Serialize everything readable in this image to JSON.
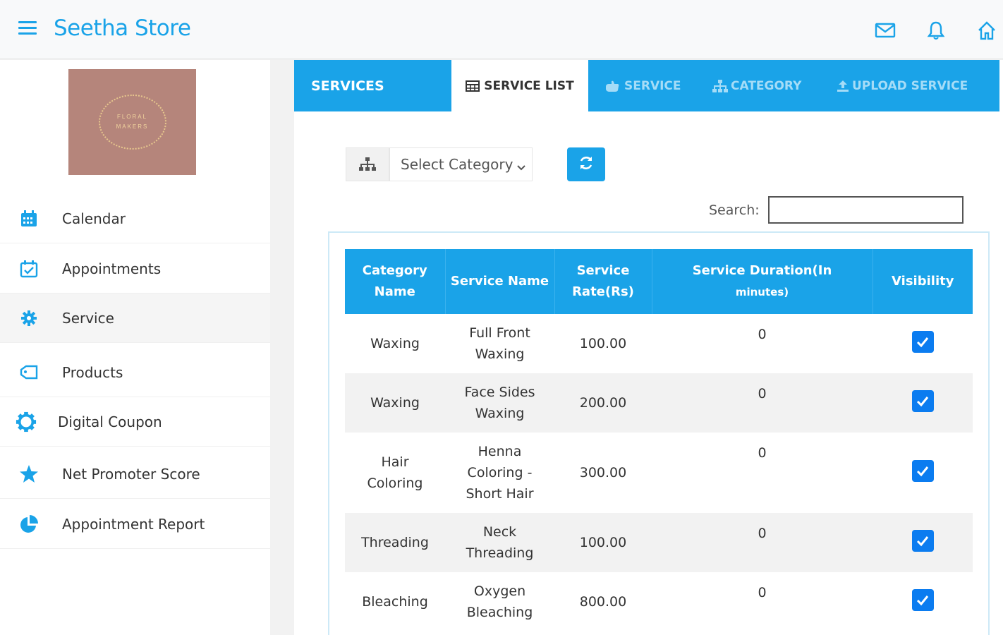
{
  "app": {
    "title": "Seetha Store"
  },
  "header": {
    "icons": [
      "mail-icon",
      "bell-icon",
      "home-icon"
    ]
  },
  "logo": {
    "line1": "FLORAL",
    "line2": "MAKERS"
  },
  "sidebar": {
    "items": [
      {
        "label": "Calendar",
        "icon": "calendar-icon"
      },
      {
        "label": "Appointments",
        "icon": "calendar-check-icon"
      },
      {
        "label": "Service",
        "icon": "gear-icon",
        "active": true
      },
      {
        "label": "Products",
        "icon": "tag-icon"
      },
      {
        "label": "Digital Coupon",
        "icon": "badge-icon"
      },
      {
        "label": "Net Promoter Score",
        "icon": "star-icon"
      },
      {
        "label": "Appointment Report",
        "icon": "pie-chart-icon"
      }
    ]
  },
  "tabs": {
    "title": "SERVICES",
    "items": [
      {
        "label": "SERVICE LIST",
        "icon": "table-icon",
        "active": true
      },
      {
        "label": "SERVICE",
        "icon": "hand-icon"
      },
      {
        "label": "CATEGORY",
        "icon": "sitemap-icon"
      },
      {
        "label": "UPLOAD SERVICE",
        "icon": "upload-icon"
      }
    ]
  },
  "filter": {
    "select_value": "Select Category",
    "search_label": "Search:",
    "search_value": ""
  },
  "table": {
    "headers": [
      "Category Name",
      "Service Name",
      "Service Rate(Rs)",
      "Service Duration(In",
      "minutes)",
      "Visibility"
    ],
    "rows": [
      {
        "category": [
          "Waxing"
        ],
        "service": [
          "Full Front",
          "Waxing"
        ],
        "rate": "100.00",
        "duration": "0",
        "visible": true
      },
      {
        "category": [
          "Waxing"
        ],
        "service": [
          "Face Sides",
          "Waxing"
        ],
        "rate": "200.00",
        "duration": "0",
        "visible": true
      },
      {
        "category": [
          "Hair",
          "Coloring"
        ],
        "service": [
          "Henna",
          "Coloring -",
          "Short Hair"
        ],
        "rate": "300.00",
        "duration": "0",
        "visible": true
      },
      {
        "category": [
          "Threading"
        ],
        "service": [
          "Neck",
          "Threading"
        ],
        "rate": "100.00",
        "duration": "0",
        "visible": true
      },
      {
        "category": [
          "Bleaching"
        ],
        "service": [
          "Oxygen",
          "Bleaching"
        ],
        "rate": "800.00",
        "duration": "0",
        "visible": true
      }
    ]
  },
  "colors": {
    "accent": "#1aa3e8",
    "checkbox": "#0b7cf0"
  }
}
